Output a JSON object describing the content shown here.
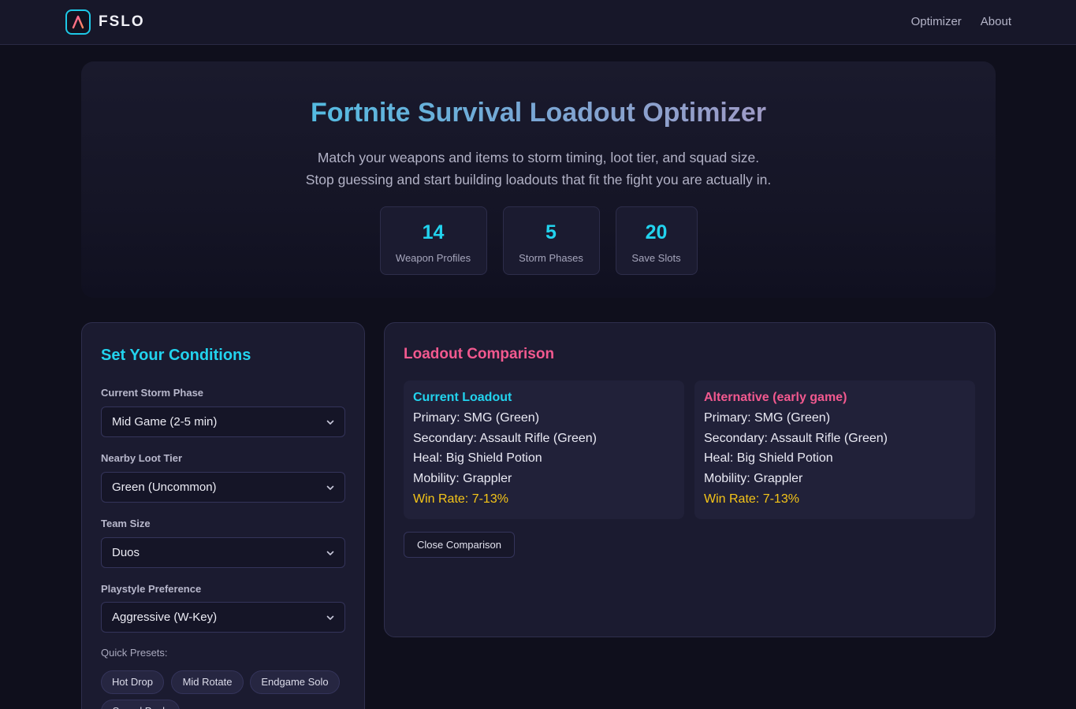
{
  "nav": {
    "brand": "FSLO",
    "links": [
      "Optimizer",
      "About"
    ]
  },
  "hero": {
    "title": "Fortnite Survival Loadout Optimizer",
    "subtitle_line1": "Match your weapons and items to storm timing, loot tier, and squad size.",
    "subtitle_line2": "Stop guessing and start building loadouts that fit the fight you are actually in.",
    "stats": [
      {
        "value": "14",
        "label": "Weapon Profiles"
      },
      {
        "value": "5",
        "label": "Storm Phases"
      },
      {
        "value": "20",
        "label": "Save Slots"
      }
    ]
  },
  "conditions": {
    "title": "Set Your Conditions",
    "fields": [
      {
        "label": "Current Storm Phase",
        "value": "Mid Game (2-5 min)"
      },
      {
        "label": "Nearby Loot Tier",
        "value": "Green (Uncommon)"
      },
      {
        "label": "Team Size",
        "value": "Duos"
      },
      {
        "label": "Playstyle Preference",
        "value": "Aggressive (W-Key)"
      }
    ],
    "presets_label": "Quick Presets:",
    "presets": [
      "Hot Drop",
      "Mid Rotate",
      "Endgame Solo",
      "Squad Push"
    ]
  },
  "comparison": {
    "title": "Loadout Comparison",
    "current": {
      "title": "Current Loadout",
      "primary": "Primary: SMG (Green)",
      "secondary": "Secondary: Assault Rifle (Green)",
      "heal": "Heal: Big Shield Potion",
      "mobility": "Mobility: Grappler",
      "win_rate": "Win Rate: 7-13%"
    },
    "alternative": {
      "title": "Alternative (early game)",
      "primary": "Primary: SMG (Green)",
      "secondary": "Secondary: Assault Rifle (Green)",
      "heal": "Heal: Big Shield Potion",
      "mobility": "Mobility: Grappler",
      "win_rate": "Win Rate: 7-13%"
    },
    "close_label": "Close Comparison"
  },
  "colors": {
    "accent_cyan": "#22d3ee",
    "accent_pink": "#f2598f",
    "win_rate_yellow": "#f5c518",
    "background": "#0f0f1c",
    "panel": "#1b1b30"
  },
  "icons": {
    "logo": "a-logo-icon",
    "select_arrow": "chevron-down-icon"
  }
}
